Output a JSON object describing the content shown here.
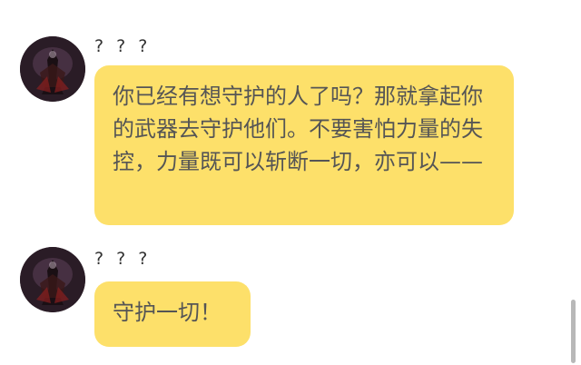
{
  "messages": [
    {
      "sender": "? ? ?",
      "avatar_icon": "dark-warrior-avatar",
      "text": "你已经有想守护的人了吗？那就拿起你的武器去守护他们。不要害怕力量的失控，力量既可以斩断一切，亦可以——"
    },
    {
      "sender": "? ? ?",
      "avatar_icon": "dark-warrior-avatar",
      "text": "守护一切！"
    }
  ],
  "colors": {
    "bubble": "#fde06a",
    "text": "#555555",
    "background": "#ffffff"
  }
}
